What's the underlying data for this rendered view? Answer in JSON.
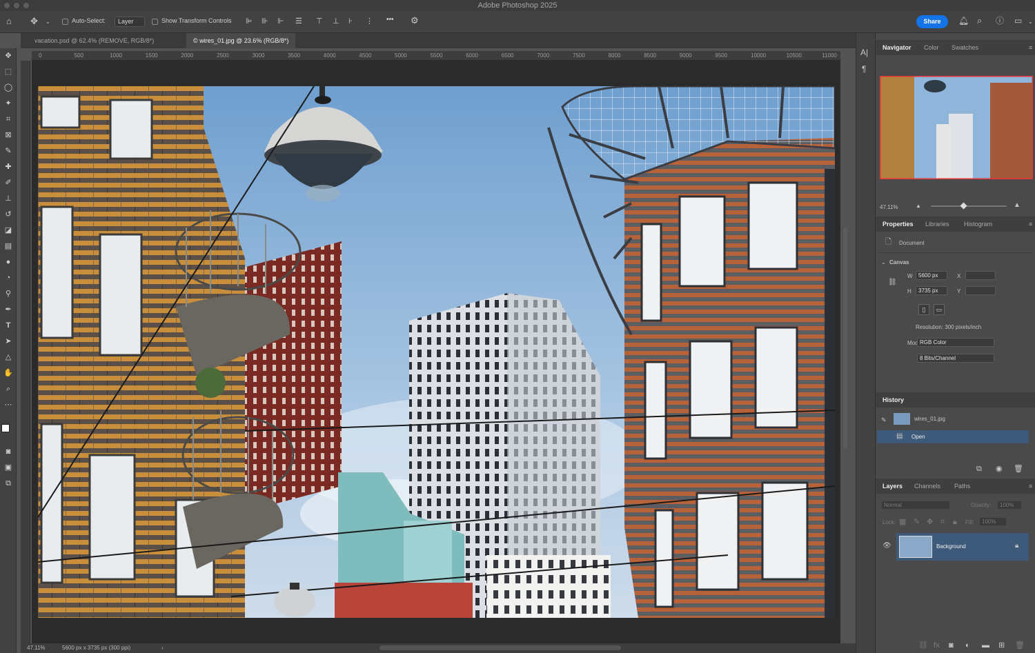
{
  "app": {
    "title": "Adobe Photoshop 2025"
  },
  "options": {
    "auto_select_label": "Auto-Select:",
    "auto_select_value": "Layer",
    "show_transform_label": "Show Transform Controls",
    "more_label": "•••",
    "share_label": "Share"
  },
  "documents": [
    {
      "label": "vacation.psd @ 62.4% (REMOVE, RGB/8*)"
    },
    {
      "label": "© wires_01.jpg @ 23.6% (RGB/8*)"
    }
  ],
  "ruler": {
    "ticks": [
      "0",
      "500",
      "1000",
      "1500",
      "2000",
      "2500",
      "3000",
      "3500",
      "4000",
      "4500",
      "5000",
      "5500",
      "6000",
      "6500",
      "7000",
      "7500",
      "8000",
      "8500",
      "9000",
      "9500",
      "10000",
      "10500",
      "11000"
    ]
  },
  "status": {
    "zoom": "47.11%",
    "info": "5600 px x 3735 px (300 ppi)",
    "arrow": "›"
  },
  "navigator": {
    "tabs": [
      "Navigator",
      "Color",
      "Swatches"
    ],
    "zoom": "47.11%"
  },
  "properties": {
    "tabs": [
      "Properties",
      "Libraries",
      "Histogram"
    ],
    "document_label": "Document",
    "canvas_label": "Canvas",
    "w_label": "W",
    "w_value": "5600 px",
    "h_label": "H",
    "h_value": "3735 px",
    "x_label": "X",
    "y_label": "Y",
    "resolution": "Resolution: 300 pixels/inch",
    "mode_label": "Mode",
    "mode_value": "RGB Color",
    "bits_value": "8 Bits/Channel"
  },
  "history": {
    "title": "History",
    "snapshot": "wires_01.jpg",
    "state": "Open"
  },
  "layers": {
    "tabs": [
      "Layers",
      "Channels",
      "Paths"
    ],
    "blend": "Normal",
    "opacity_label": "Opacity:",
    "opacity_value": "100%",
    "lock_label": "Lock:",
    "fill_label": "Fill:",
    "fill_value": "100%",
    "layer_name": "Background"
  },
  "colors": {
    "accent": "#1473e6",
    "selection": "#3d5a7a",
    "navigator_frame": "#e8333a"
  }
}
